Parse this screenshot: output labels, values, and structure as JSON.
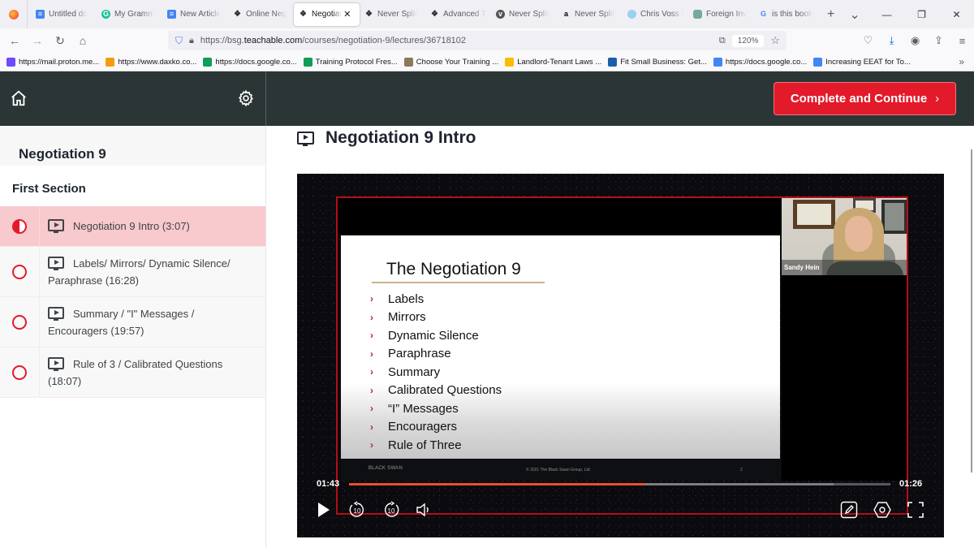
{
  "browser": {
    "tabs": [
      {
        "label": "Untitled do",
        "favicon": "google-docs-icon",
        "active": false
      },
      {
        "label": "My Gramm",
        "favicon": "grammarly-icon",
        "active": false
      },
      {
        "label": "New Article",
        "favicon": "google-docs-icon",
        "active": false
      },
      {
        "label": "Online Neg",
        "favicon": "black-swan-icon",
        "active": false
      },
      {
        "label": "Negotiat",
        "favicon": "black-swan-icon",
        "active": true
      },
      {
        "label": "Never Split",
        "favicon": "black-swan-icon",
        "active": false
      },
      {
        "label": "Advanced T",
        "favicon": "black-swan-icon",
        "active": false
      },
      {
        "label": "Never Split",
        "favicon": "vox-icon",
        "active": false
      },
      {
        "label": "Never Split",
        "favicon": "amazon-icon",
        "active": false
      },
      {
        "label": "Chris Voss N",
        "favicon": "globe-icon",
        "active": false
      },
      {
        "label": "Foreign Inv",
        "favicon": "chatgpt-icon",
        "active": false
      },
      {
        "label": "is this book",
        "favicon": "google-icon",
        "active": false
      }
    ],
    "url": {
      "prefix": "https://bsg.",
      "domain": "teachable.com",
      "path": "/courses/negotiation-9/lectures/36718102"
    },
    "zoom_level": "120%",
    "bookmarks": [
      {
        "label": "https://mail.proton.me...",
        "icon": "proton-mail-icon",
        "color": "#6d4aff"
      },
      {
        "label": "https://www.daxko.co...",
        "icon": "daxko-icon",
        "color": "#f39c12"
      },
      {
        "label": "https://docs.google.co...",
        "icon": "google-sheets-icon",
        "color": "#0f9d58"
      },
      {
        "label": "Training Protocol Fres...",
        "icon": "google-sheets-icon",
        "color": "#0f9d58"
      },
      {
        "label": "Choose Your Training ...",
        "icon": "bookmark-image-icon",
        "color": "#8a7a5a"
      },
      {
        "label": "Landlord-Tenant Laws ...",
        "icon": "google-drive-icon",
        "color": "#fbbc04"
      },
      {
        "label": "Fit Small Business: Get...",
        "icon": "fsb-icon",
        "color": "#1b5fa6"
      },
      {
        "label": "https://docs.google.co...",
        "icon": "google-docs-icon",
        "color": "#4285f4"
      },
      {
        "label": "Increasing EEAT for To...",
        "icon": "google-docs-icon",
        "color": "#4285f4"
      }
    ]
  },
  "header": {
    "complete_button": "Complete and Continue",
    "complete_chevron": "›",
    "accent_color": "#e21a2a"
  },
  "sidebar": {
    "course_title": "Negotiation 9",
    "section_title": "First Section",
    "lectures": [
      {
        "title": "Negotiation 9 Intro (3:07)",
        "status": "in-progress",
        "active": true
      },
      {
        "title": "Labels/ Mirrors/ Dynamic Silence/ Paraphrase (16:28)",
        "status": "not-started",
        "active": false
      },
      {
        "title": "Summary / \"I\" Messages / Encouragers (19:57)",
        "status": "not-started",
        "active": false
      },
      {
        "title": "Rule of 3 / Calibrated Questions (18:07)",
        "status": "not-started",
        "active": false
      }
    ]
  },
  "main": {
    "lecture_title": "Negotiation 9 Intro"
  },
  "video": {
    "slide": {
      "title": "The Negotiation 9",
      "bullet": "›",
      "items": [
        "Labels",
        "Mirrors",
        "Dynamic Silence",
        "Paraphrase",
        "Summary",
        "Calibrated Questions",
        "“I” Messages",
        "Encouragers",
        "Rule of Three"
      ],
      "footer_logo": "BLACK SWAN",
      "footer_copyright": "© 2021 The Black Swan Group, Ltd",
      "page_number": "2"
    },
    "speaker_name": "Sandy Hein",
    "elapsed": "01:43",
    "remaining": "01:26",
    "progress": 0.545,
    "buffered": 0.895,
    "rewind_label": "10",
    "forward_label": "10"
  }
}
